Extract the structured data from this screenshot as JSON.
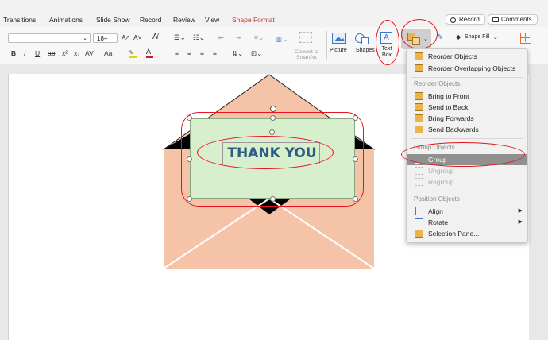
{
  "tabs": [
    "Transitions",
    "Animations",
    "Slide Show",
    "Record",
    "Review",
    "View",
    "Shape Format"
  ],
  "record_button": "Record",
  "comments_button": "Comments",
  "font_size": "18+",
  "font_size_buttons": [
    "A˄",
    "A˅"
  ],
  "format_buttons": [
    "B",
    "I",
    "U",
    "ab",
    "x²",
    "x₂",
    "AV",
    "Aa"
  ],
  "convert_smartart": [
    "Convert to",
    "SmartArt"
  ],
  "picture_label": "Picture",
  "shapes_label": "Shapes",
  "textbox_label": [
    "Text",
    "Box"
  ],
  "shape_fill_label": "Shape Fill",
  "slide_text": "THANK YOU",
  "menu": {
    "top_items": [
      "Reorder Objects",
      "Reorder Overlapping Objects"
    ],
    "reorder_header": "Reorder Objects",
    "reorder_items": [
      "Bring to Front",
      "Send to Back",
      "Bring Forwards",
      "Send Backwards"
    ],
    "group_header": "Group Objects",
    "group_items": [
      "Group",
      "Ungroup",
      "Regroup"
    ],
    "position_header": "Position Objects",
    "position_items": [
      "Align",
      "Rotate",
      "Selection Pane..."
    ],
    "submenu_arrow": "▶"
  },
  "colors": {
    "accent_red": "#e3161f",
    "envelope": "#f5c4a8",
    "card": "#d7efcc",
    "thank_you": "#2d5d84",
    "menu_highlight": "#909090"
  }
}
